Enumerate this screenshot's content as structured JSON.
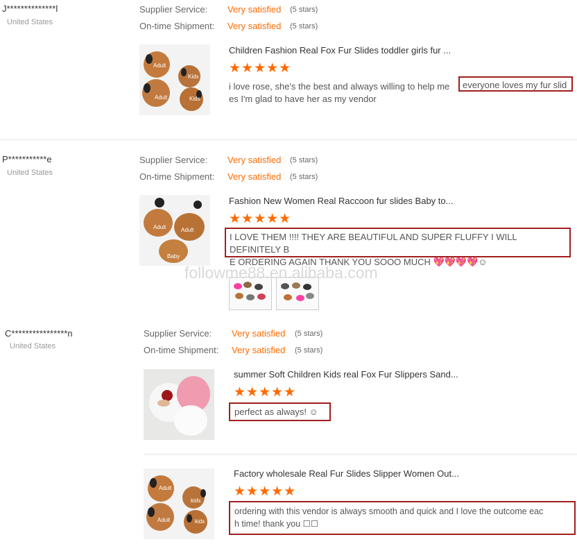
{
  "labels": {
    "supplier_service": "Supplier Service:",
    "ontime_shipment": "On-time Shipment:"
  },
  "reviews": [
    {
      "buyer": "J**************l",
      "country": "United States",
      "supplier_service": {
        "value": "Very satisfied",
        "stars": "(5 stars)"
      },
      "ontime_shipment": {
        "value": "Very satisfied",
        "stars": "(5 stars)"
      },
      "product_title": "Children Fashion Real Fox Fur Slides toddler girls fur ...",
      "rating": "★★★★★",
      "comment_line1_plain": "i love rose, she's the best and always willing to help me",
      "comment_line1_boxed": "everyone loves my fur slid",
      "comment_line2": "es I'm glad to have her as my vendor",
      "thumb_labels": {
        "a": "Adult",
        "b": "Kids",
        "c": "Adult",
        "d": "Kids"
      }
    },
    {
      "buyer": "P***********e",
      "country": "United States",
      "supplier_service": {
        "value": "Very satisfied",
        "stars": "(5 stars)"
      },
      "ontime_shipment": {
        "value": "Very satisfied",
        "stars": "(5 stars)"
      },
      "product_title": "Fashion New Women Real Raccoon fur slides Baby to...",
      "rating": "★★★★★",
      "comment_line1": "I LOVE THEM !!!! THEY ARE BEAUTIFUL AND SUPER FLUFFY I WILL DEFINITELY B",
      "comment_line2": "E ORDERING AGAIN THANK YOU SOOO MUCH 💖💖💖💖☺",
      "thumb_labels": {
        "a": "Adult",
        "b": "Adult",
        "c": "Baby"
      }
    },
    {
      "buyer": "C****************n",
      "country": "United States",
      "supplier_service": {
        "value": "Very satisfied",
        "stars": "(5 stars)"
      },
      "ontime_shipment": {
        "value": "Very satisfied",
        "stars": "(5 stars)"
      },
      "products": [
        {
          "product_title": "summer Soft Children Kids real Fox Fur Slippers Sand...",
          "rating": "★★★★★",
          "comment": "perfect as always! ☺"
        },
        {
          "product_title": "Factory wholesale Real Fur Slides Slipper Women Out...",
          "rating": "★★★★★",
          "comment_line1": "ordering with this vendor is always smooth and quick and I love the outcome eac",
          "comment_line2": "h time! thank you ☐☐",
          "thumb_labels": {
            "a": "Adult",
            "b": "kids",
            "c": "Adult",
            "d": "kids"
          }
        }
      ]
    }
  ],
  "watermark": "followme88.en.alibaba.com",
  "colors": {
    "accent": "#ff6a00",
    "highlight_box": "#a01e1e",
    "fur": "#c4753a"
  },
  "icons": {
    "star": "star-icon"
  }
}
